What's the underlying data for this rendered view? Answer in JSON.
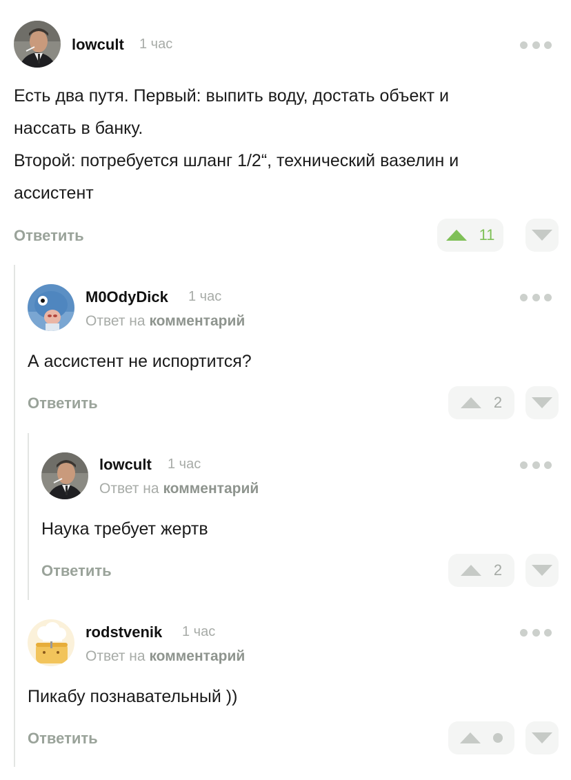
{
  "comments": [
    {
      "username": "lowcult",
      "time": "1 час",
      "text": "Есть два путя. Первый: выпить воду, достать объект и\nнассать в банку.\nВторой: потребуется шланг 1/2“, технический вазелин и\nассистент",
      "reply_label": "Ответить",
      "score": "11"
    },
    {
      "username": "M0OdyDick",
      "time": "1 час",
      "reply_to_prefix": "Ответ на",
      "reply_to_link": "комментарий",
      "text": "А ассистент не испортится?",
      "reply_label": "Ответить",
      "score": "2"
    },
    {
      "username": "lowcult",
      "time": "1 час",
      "reply_to_prefix": "Ответ на",
      "reply_to_link": "комментарий",
      "text": "Наука требует жертв",
      "reply_label": "Ответить",
      "score": "2"
    },
    {
      "username": "rodstvenik",
      "time": "1 час",
      "reply_to_prefix": "Ответ на",
      "reply_to_link": "комментарий",
      "text": "Пикабу познавательный ))",
      "reply_label": "Ответить",
      "score": ""
    }
  ],
  "colors": {
    "upvote_active": "#7fc057",
    "muted": "#a7aba7",
    "button_bg": "#f4f5f4"
  },
  "icons": {
    "more": "more-dots-icon",
    "upvote": "upvote-arrow-icon",
    "downvote": "downvote-arrow-icon"
  }
}
